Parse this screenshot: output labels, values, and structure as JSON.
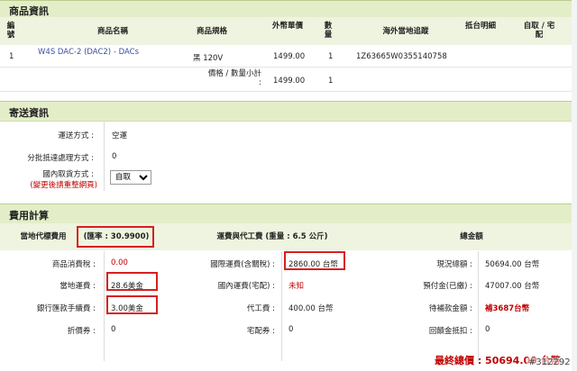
{
  "product_section": {
    "title": "商品資訊",
    "headers": {
      "no": "編號",
      "name": "商品名稱",
      "spec": "商品規格",
      "price": "外幣單價",
      "qty": "數量",
      "track": "海外當地追蹤",
      "detail": "抵台明細",
      "pickup": "自取 / 宅配"
    },
    "row": {
      "no": "1",
      "name": "W4S DAC-2 (DAC2) - DACs",
      "spec": "黑 120V",
      "price": "1499.00",
      "qty": "1",
      "track": "1Z63665W0355140758"
    },
    "subtotal": {
      "label": "價格 / 數量小計 :",
      "price": "1499.00",
      "qty": "1"
    }
  },
  "shipping_section": {
    "title": "寄送資訊",
    "method_label": "運送方式 :",
    "method_value": "空運",
    "split_label": "分批抵達處理方式 :",
    "split_value": "0",
    "pickup_label": "國內取貨方式 :",
    "pickup_note": "(變更後請重整網頁)",
    "pickup_select": "自取"
  },
  "fee_section": {
    "title": "費用計算",
    "local_header": "當地代標費用",
    "rate": "(匯率 : 30.9900)",
    "freight_header": "運費與代工費 (重量 : 6.5 公斤)",
    "total_header": "總金額",
    "rows": [
      {
        "l1": "商品消費稅 :",
        "v1": "0.00",
        "l2": "國際運費(含關稅) :",
        "v2": "2860.00 台幣",
        "l3": "現況總額 :",
        "v3": "50694.00 台幣"
      },
      {
        "l1": "當地運費 :",
        "v1": "28.6美金",
        "l2": "國內運費(宅配) :",
        "v2": "未知",
        "l3": "預付金(已繳) :",
        "v3": "47007.00 台幣"
      },
      {
        "l1": "銀行匯款手續費 :",
        "v1": "3.00美金",
        "l2": "代工費 :",
        "v2": "400.00 台幣",
        "l3": "待補款金額 :",
        "v3": "補3687台幣"
      },
      {
        "l1": "折價券 :",
        "v1": "0",
        "l2": "宅配券 :",
        "v2": "0",
        "l3": "回饋金抵扣 :",
        "v3": "0"
      }
    ],
    "final_total": "最終總價 : 50694.00 台幣",
    "watermark": "#312292"
  }
}
